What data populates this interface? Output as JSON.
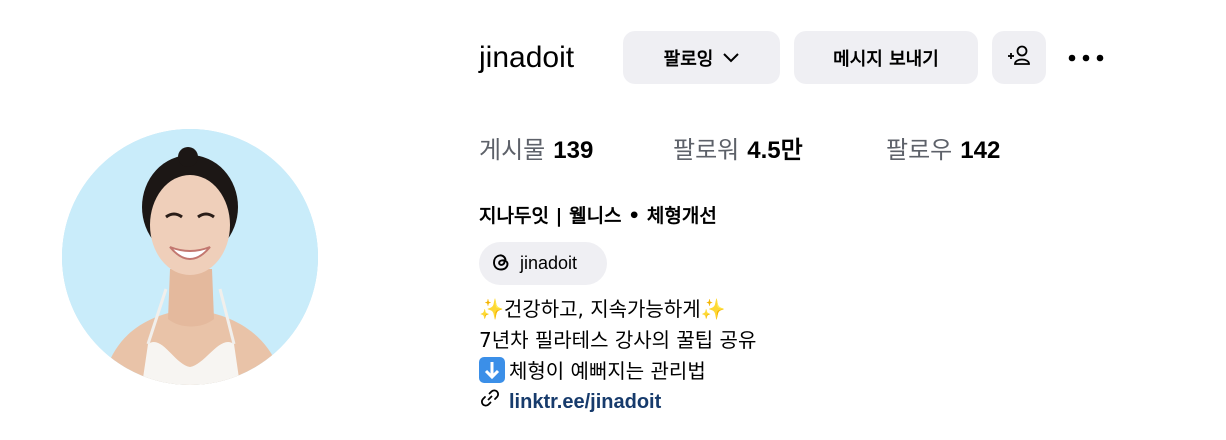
{
  "profile": {
    "username": "jinadoit",
    "follow_button": "팔로잉",
    "message_button": "메시지 보내기",
    "add_button_icon": "person-add-icon",
    "more_icon": "more-options-icon",
    "stats": {
      "posts_label": "게시물",
      "posts_value": "139",
      "followers_label": "팔로워",
      "followers_value": "4.5만",
      "following_label": "팔로우",
      "following_value": "142"
    },
    "full_name": "지나두잇 | 웰니스 • 체형개선",
    "threads": {
      "icon": "threads-icon",
      "handle": "jinadoit"
    },
    "bio": {
      "line1_text": "건강하고, 지속가능하게",
      "line1_emoji": "✨",
      "line2": "7년차 필라테스 강사의 꿀팁 공유",
      "line3_text": "체형이 예뻐지는 관리법",
      "line3_emoji_icon": "down-arrow-emoji"
    },
    "link": {
      "icon": "link-icon",
      "text": "linktr.ee/jinadoit"
    },
    "colors": {
      "button_bg": "#efeff3",
      "link": "#173b6c",
      "avatar_bg": "#c9ecfa",
      "muted_text": "#5d6169"
    }
  }
}
